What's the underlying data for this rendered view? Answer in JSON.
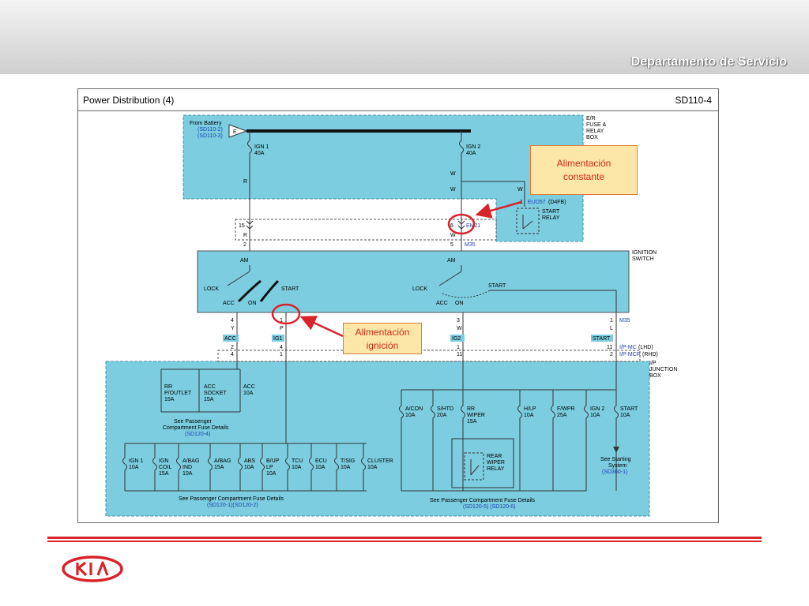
{
  "header": {
    "department": "Departamento de Servicio"
  },
  "diagram": {
    "title": "Power Distribution (4)",
    "code": "SD110-4",
    "boxes": {
      "er_fuse_relay": [
        "E/R",
        "FUSE &",
        "RELAY",
        "BOX"
      ],
      "ignition_switch": [
        "IGNITION",
        "SWITCH"
      ],
      "ip_junction": [
        "I/P",
        "JUNCTION",
        "BOX"
      ]
    },
    "battery": {
      "label": "From Battery",
      "refs": [
        "(SD110-2)",
        "(SD110-3)"
      ],
      "terminal": "E"
    },
    "fuses_top": [
      {
        "name": "IGN 1",
        "rating": "40A"
      },
      {
        "name": "IGN 2",
        "rating": "40A"
      }
    ],
    "wire_labels": {
      "r": "R",
      "w": "W",
      "y": "Y",
      "p": "P",
      "l": "L"
    },
    "pins": {
      "p15": "15",
      "p2": "2",
      "p6": "6",
      "p5": "5",
      "p1": "1",
      "p4": "4",
      "p3": "3",
      "p11": "11"
    },
    "connectors": {
      "em21": "EM21",
      "m35": "M35",
      "eud57": "EUD57",
      "d4fb": "(D4FB)",
      "ipmc": "I/P-MC",
      "ipmcr": "I/P-MCR",
      "lhd": "(LHD)",
      "rhd": "(RHD)"
    },
    "relays": {
      "start": [
        "START",
        "RELAY"
      ],
      "rear_wiper": [
        "REAR",
        "WIPER",
        "RELAY"
      ]
    },
    "switch": {
      "am": "AM",
      "lock": "LOCK",
      "acc": "ACC",
      "on": "ON",
      "start": "START"
    },
    "bus_tags": {
      "acc": "ACC",
      "ig1": "IG1",
      "ig2": "IG2",
      "start": "START"
    },
    "upper_left_fuses": [
      {
        "lines": [
          "RR",
          "P/OUTLET",
          "15A"
        ]
      },
      {
        "lines": [
          "ACC",
          "SOCKET",
          "15A"
        ]
      },
      {
        "lines": [
          "ACC",
          "10A"
        ]
      }
    ],
    "bottom_left_fuses": [
      {
        "lines": [
          "IGN 1",
          "10A"
        ]
      },
      {
        "lines": [
          "IGN",
          "COIL",
          "15A"
        ]
      },
      {
        "lines": [
          "A/BAG",
          "IND",
          "10A"
        ]
      },
      {
        "lines": [
          "A/BAG",
          "15A"
        ]
      },
      {
        "lines": [
          "ABS",
          "10A"
        ]
      },
      {
        "lines": [
          "B/UP",
          "LP",
          "10A"
        ]
      },
      {
        "lines": [
          "TCU",
          "10A"
        ]
      },
      {
        "lines": [
          "ECU",
          "10A"
        ]
      },
      {
        "lines": [
          "T/SIG",
          "10A"
        ]
      },
      {
        "lines": [
          "CLUSTER",
          "10A"
        ]
      }
    ],
    "right_fuses": [
      {
        "lines": [
          "A/CON",
          "10A"
        ]
      },
      {
        "lines": [
          "S/HTD",
          "20A"
        ]
      },
      {
        "lines": [
          "RR",
          "WIPER",
          "15A"
        ]
      },
      {
        "lines": [
          "H/LP",
          "10A"
        ]
      },
      {
        "lines": [
          "F/WPR",
          "25A"
        ]
      },
      {
        "lines": [
          "IGN 2",
          "10A"
        ]
      },
      {
        "lines": [
          "START",
          "10A"
        ]
      }
    ],
    "notes": {
      "pc_sd1204": [
        "See Passenger",
        "Compartment Fuse Details",
        "(SD120-4)"
      ],
      "pc_left": [
        "See Passenger Compartment Fuse Details",
        "(SD120-1)(SD120-2)"
      ],
      "pc_right": [
        "See Passenger Compartment Fuse Details",
        "(SD120-5) (SD120-6)"
      ],
      "starting": [
        "See Starting",
        "System",
        "(SD360-1)"
      ]
    }
  },
  "callouts": {
    "constant": [
      "Alimentación",
      "constante"
    ],
    "ignition": [
      "Alimentación",
      "ignición"
    ]
  },
  "colors": {
    "box_fill": "#7ccde0",
    "wire": "#333333",
    "callout_fill": "#fde7a8",
    "callout_text": "#d12a1a",
    "red": "#d8232a",
    "link": "#1a3fb0"
  }
}
